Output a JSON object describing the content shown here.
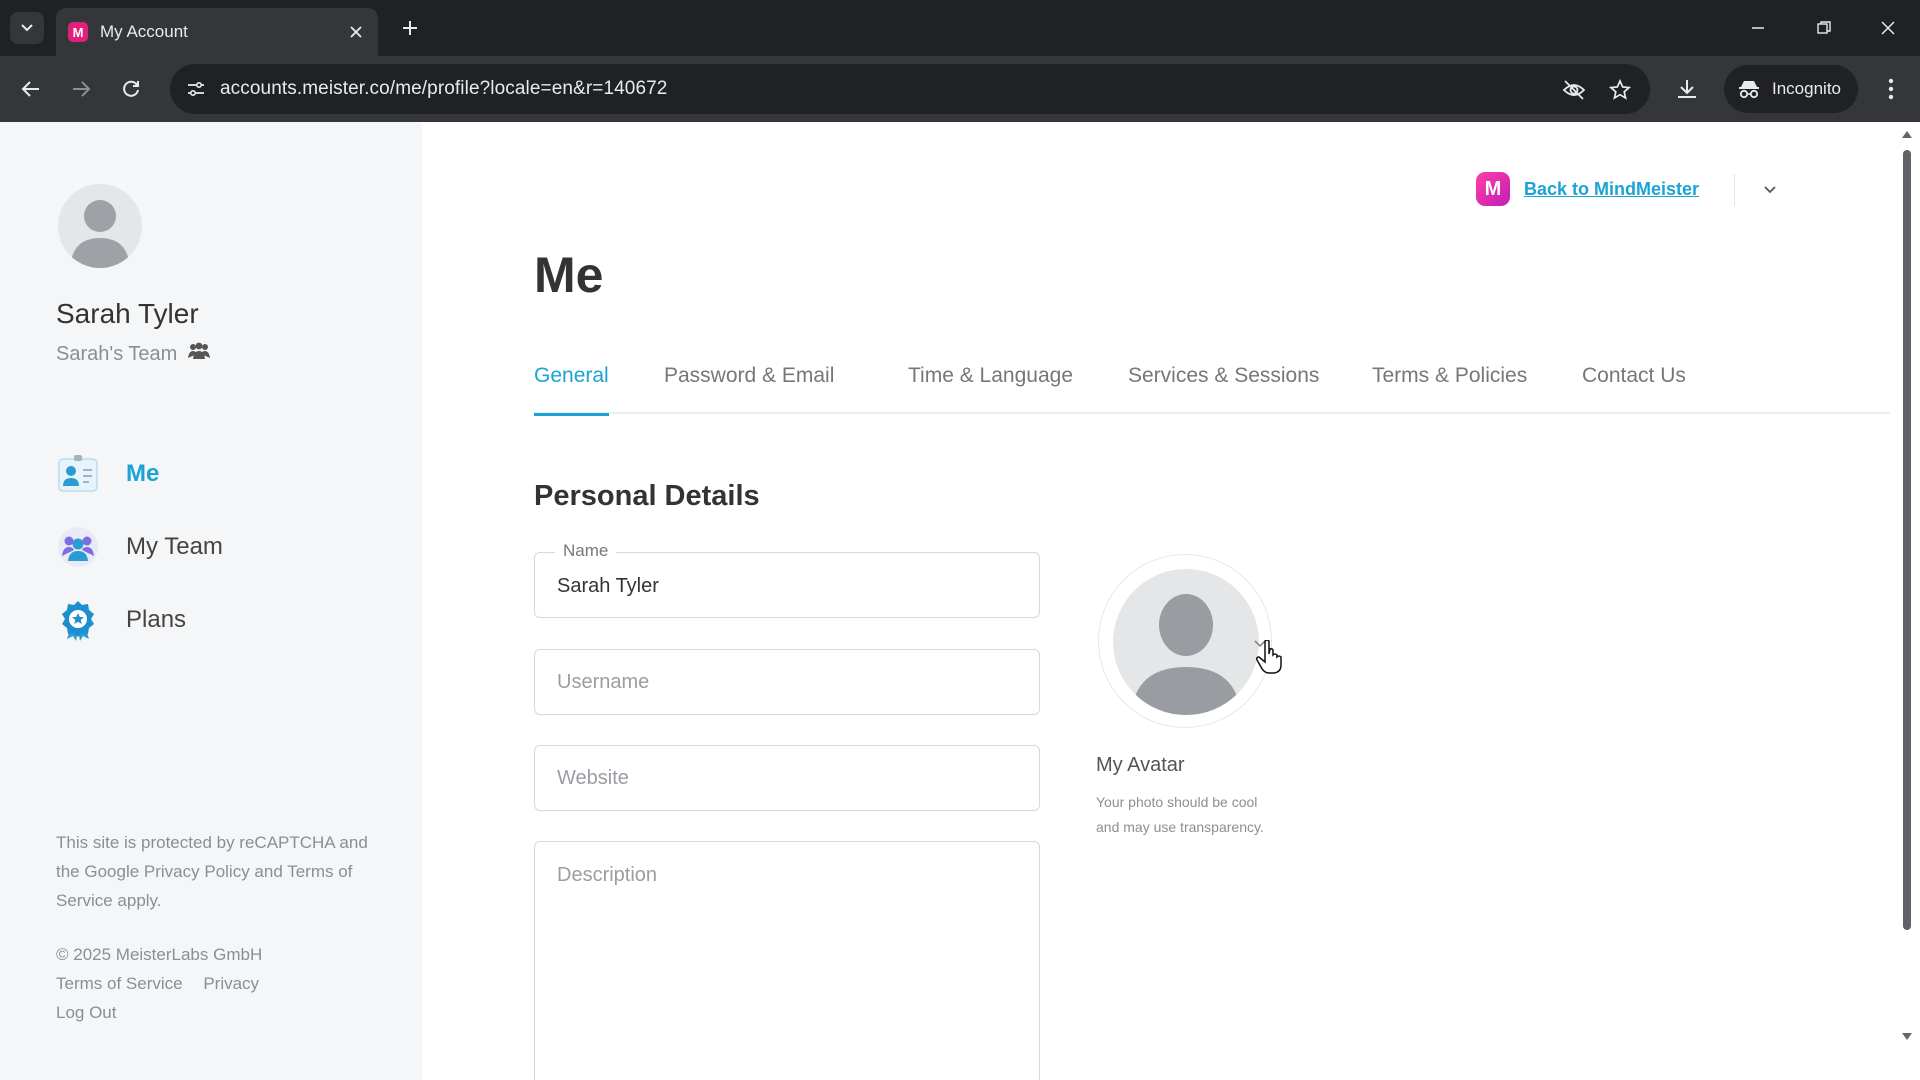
{
  "browser": {
    "tab_title": "My Account",
    "url": "accounts.meister.co/me/profile?locale=en&r=140672",
    "incognito_label": "Incognito",
    "favicon_letter": "M"
  },
  "sidebar": {
    "user_name": "Sarah Tyler",
    "team_name": "Sarah's Team",
    "nav": [
      {
        "label": "Me",
        "icon": "profile-card-icon",
        "active": true
      },
      {
        "label": "My Team",
        "icon": "team-icon",
        "active": false
      },
      {
        "label": "Plans",
        "icon": "badge-icon",
        "active": false
      }
    ],
    "recaptcha_text": "This site is protected by reCAPTCHA and the Google Privacy Policy and Terms of Service apply.",
    "copyright": "© 2025 MeisterLabs GmbH",
    "footer_links": [
      "Terms of Service",
      "Privacy"
    ],
    "logout": "Log Out"
  },
  "header": {
    "back_link": "Back to MindMeister",
    "logo_letter": "M"
  },
  "main": {
    "title": "Me",
    "tabs": [
      "General",
      "Password & Email",
      "Time & Language",
      "Services & Sessions",
      "Terms & Policies",
      "Contact Us"
    ],
    "active_tab": "General",
    "section_title": "Personal Details",
    "form": {
      "name_label": "Name",
      "name_value": "Sarah Tyler",
      "username_placeholder": "Username",
      "website_placeholder": "Website",
      "description_placeholder": "Description"
    },
    "avatar": {
      "title": "My Avatar",
      "hint": "Your photo should be cool and may use transparency."
    }
  },
  "colors": {
    "accent": "#1aa3d4",
    "brand": "#e0207c",
    "sidebar_bg": "#f5f6f7"
  }
}
